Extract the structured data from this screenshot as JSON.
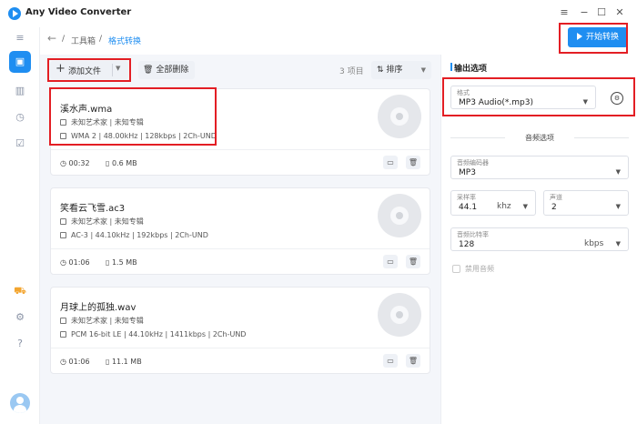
{
  "app": {
    "title": "Any Video Converter"
  },
  "window_controls": {
    "menu": "≡",
    "minimize": "−",
    "maximize": "☐",
    "close": "✕"
  },
  "sidebar": {
    "icons": [
      "collapse-icon",
      "toolbox-icon",
      "library-icon",
      "history-icon",
      "tasks-icon",
      "cart-icon",
      "settings-icon",
      "help-icon",
      "user-avatar"
    ]
  },
  "breadcrumb": {
    "back": "←",
    "sep": "/",
    "root": "工具箱",
    "current": "格式转换"
  },
  "start_button": {
    "label": "开始转换"
  },
  "toolbar": {
    "add_label": "添加文件",
    "delete_all_label": "全部删除",
    "count_label": "3 项目",
    "sort_label": "排序"
  },
  "files": [
    {
      "name": "溪水声.wma",
      "artist_album": "未知艺术家 | 未知专辑",
      "codec": "WMA 2 | 48.00kHz | 128kbps | 2Ch-UND",
      "duration": "00:32",
      "size": "0.6 MB"
    },
    {
      "name": "笑看云飞雪.ac3",
      "artist_album": "未知艺术家 | 未知专辑",
      "codec": "AC-3 | 44.10kHz | 192kbps | 2Ch-UND",
      "duration": "01:06",
      "size": "1.5 MB"
    },
    {
      "name": "月球上的孤独.wav",
      "artist_album": "未知艺术家 | 未知专辑",
      "codec": "PCM 16-bit LE | 44.10kHz | 1411kbps | 2Ch-UND",
      "duration": "01:06",
      "size": "11.1 MB"
    }
  ],
  "output": {
    "title": "输出选项",
    "format_label": "格式",
    "format_value": "MP3 Audio(*.mp3)",
    "audio_section": "音频选项",
    "encoder_label": "音频编码器",
    "encoder_value": "MP3",
    "samplerate_label": "采样率",
    "samplerate_value": "44.1",
    "samplerate_unit": "khz",
    "channel_label": "声道",
    "channel_value": "2",
    "bitrate_label": "音频比特率",
    "bitrate_value": "128",
    "bitrate_unit": "kbps",
    "disable_audio_label": "禁用音频"
  },
  "colors": {
    "accent": "#1f8ef1",
    "highlight": "#e31e24",
    "cart": "#f3a530"
  }
}
